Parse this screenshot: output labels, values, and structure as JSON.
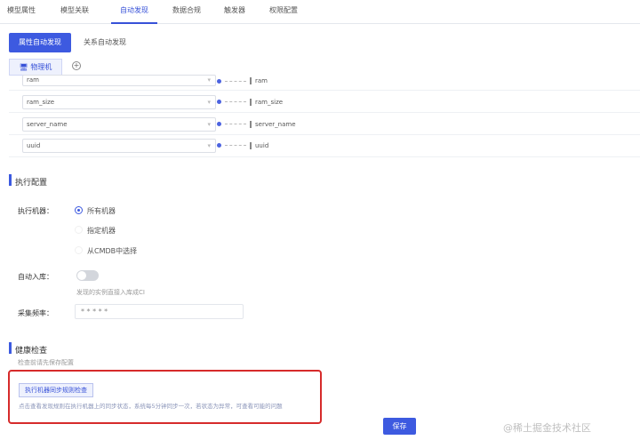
{
  "tabs": [
    {
      "label": "模型属性"
    },
    {
      "label": "模型关联"
    },
    {
      "label": "自动发现"
    },
    {
      "label": "数据合规"
    },
    {
      "label": "触发器"
    },
    {
      "label": "权限配置"
    }
  ],
  "subtabs": {
    "attr": "属性自动发现",
    "relation": "关系自动发现"
  },
  "model_tab": "🖥 物理机",
  "add_icon": "+",
  "mappings": [
    {
      "source": "ram",
      "target": "ram"
    },
    {
      "source": "ram_size",
      "target": "ram_size"
    },
    {
      "source": "server_name",
      "target": "server_name"
    },
    {
      "source": "uuid",
      "target": "uuid"
    }
  ],
  "dropdown_arrow": "▾",
  "exec_config": {
    "title": "执行配置",
    "executor_label": "执行机器：",
    "options": [
      "所有机器",
      "指定机器",
      "从CMDB中选择"
    ],
    "auto_import_label": "自动入库：",
    "auto_import_hint": "发现的实例直接入库成CI",
    "freq_label": "采集频率：",
    "freq_value": "* * * * *"
  },
  "health": {
    "title": "健康检查",
    "subtitle": "检查前请先保存配置",
    "check_button": "执行机器同步规则检查",
    "check_desc": "点击查看发现规则在执行机器上的同步状态，系统每5分钟同步一次，若状态为异常，可查看可能的问题"
  },
  "save_label": "保存",
  "watermark": "@稀土掘金技术社区",
  "colors": {
    "accent": "#3d5ae0",
    "highlight": "#d62b2b"
  }
}
